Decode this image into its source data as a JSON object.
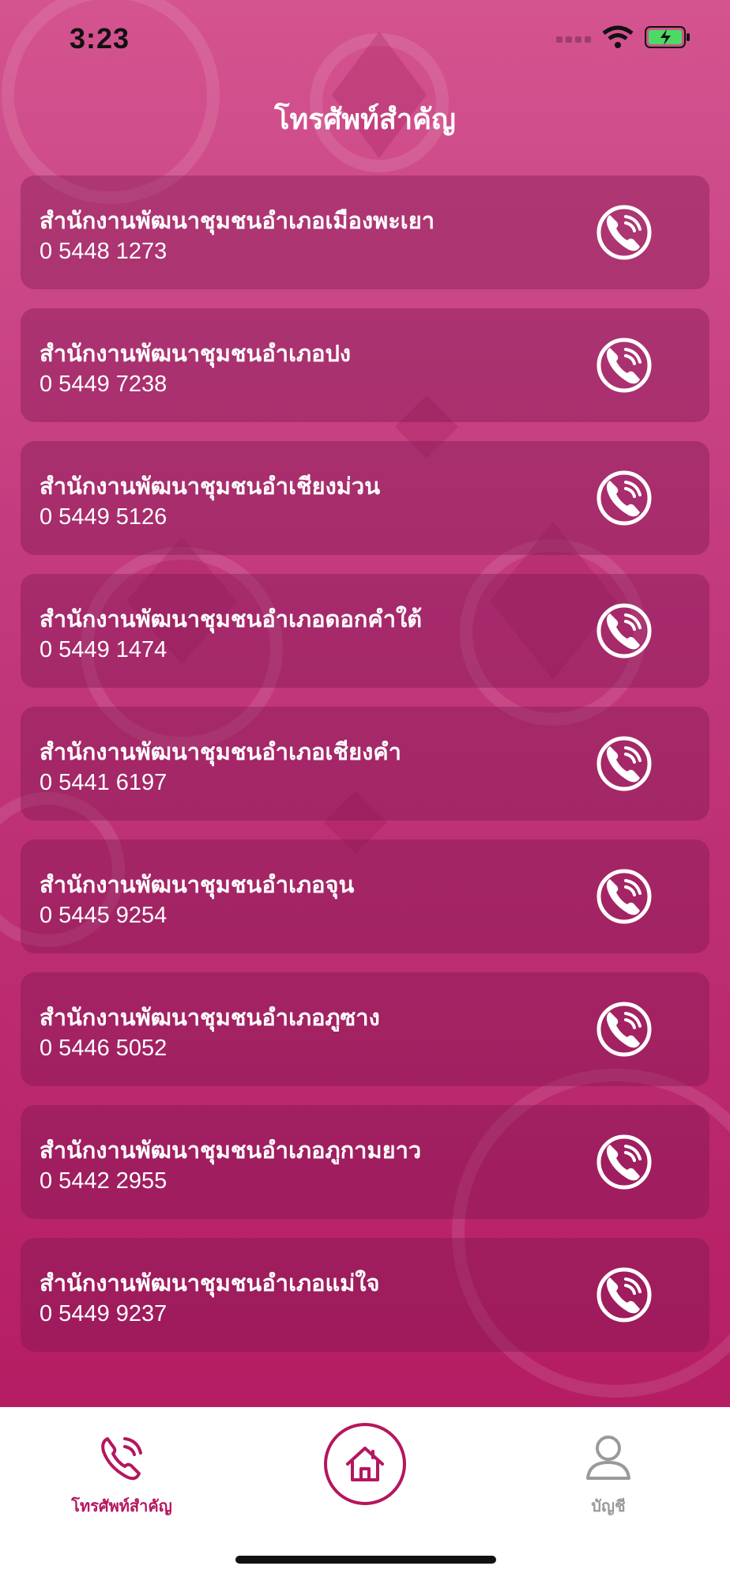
{
  "status_bar": {
    "time": "3:23"
  },
  "header": {
    "title": "โทรศัพท์สำคัญ"
  },
  "contacts": [
    {
      "name": "สำนักงานพัฒนาชุมชนอำเภอเมืองพะเยา",
      "phone": "0 5448 1273"
    },
    {
      "name": "สำนักงานพัฒนาชุมชนอำเภอปง",
      "phone": "0 5449 7238"
    },
    {
      "name": "สำนักงานพัฒนาชุมชนอำเชียงม่วน",
      "phone": "0 5449 5126"
    },
    {
      "name": "สำนักงานพัฒนาชุมชนอำเภอดอกคำใต้",
      "phone": "0 5449 1474"
    },
    {
      "name": "สำนักงานพัฒนาชุมชนอำเภอเชียงคำ",
      "phone": "0 5441 6197"
    },
    {
      "name": "สำนักงานพัฒนาชุมชนอำเภอจุน",
      "phone": "0 5445 9254"
    },
    {
      "name": "สำนักงานพัฒนาชุมชนอำเภอภูซาง",
      "phone": "0 5446 5052"
    },
    {
      "name": "สำนักงานพัฒนาชุมชนอำเภอภูกามยาว",
      "phone": "0 5442 2955"
    },
    {
      "name": "สำนักงานพัฒนาชุมชนอำเภอแม่ใจ",
      "phone": "0 5449 9237"
    }
  ],
  "tabbar": {
    "phone_tab_label": "โทรศัพท์สำคัญ",
    "account_tab_label": "บัญชี",
    "icons": {
      "phone": "phone-call-icon",
      "home": "home-icon",
      "account": "user-icon"
    }
  },
  "colors": {
    "accent": "#b5165e",
    "background_top": "#d4548f",
    "background_bottom": "#b51d63",
    "inactive": "#9a9a9a"
  }
}
